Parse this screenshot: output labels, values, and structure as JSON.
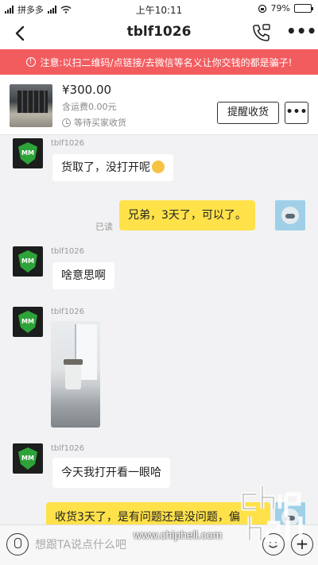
{
  "status_bar": {
    "carrier": "拼多多",
    "time": "上午10:11",
    "battery": "79%",
    "battery_level": 0.79
  },
  "nav": {
    "title": "tblf1026",
    "back_icon": "chevron-left-icon",
    "call_icon": "phone-call-icon",
    "more_icon": "more-icon"
  },
  "warning": {
    "text": "注意:以扫二维码/点链接/去微信等名义让你交钱的都是骗子!",
    "color": "#f35c5f"
  },
  "order": {
    "price": "¥300.00",
    "shipping": "含运费0.00元",
    "status": "等待买家收货",
    "remind_label": "提醒收货",
    "more_label": "•••"
  },
  "chat": {
    "messages": [
      {
        "sender": "tblf1026",
        "text": "货取了，没打开呢"
      },
      {
        "text": "兄弟，3天了，可以了。",
        "read": "已读"
      },
      {
        "sender": "tblf1026",
        "text": "啥意思啊"
      },
      {
        "sender": "tblf1026",
        "image": "photo"
      },
      {
        "sender": "tblf1026",
        "text": "今天我打开看一眼哈"
      },
      {
        "text": "收货3天了，是有问题还是没问题，偏"
      }
    ],
    "my_bubble_color": "#ffe14a"
  },
  "input": {
    "placeholder": "想跟TA说点什么吧"
  },
  "watermark": {
    "text": "www.chiphell.com"
  }
}
